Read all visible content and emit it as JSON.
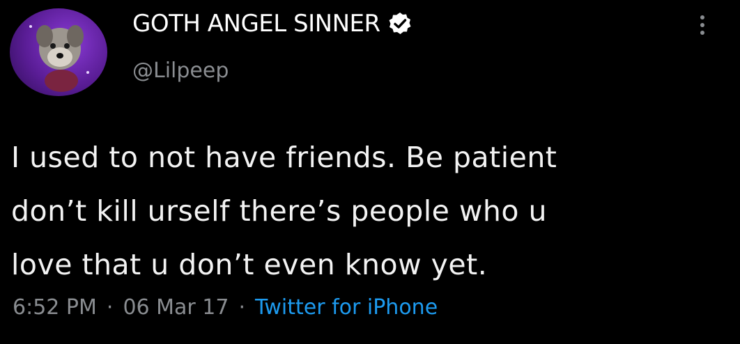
{
  "tweet": {
    "display_name": "GOTH ANGEL SINNER",
    "handle": "@Lilpeep",
    "verified": true,
    "text_lines": [
      "I used to not have friends. Be patient",
      "don’t kill urself there’s people who u",
      "love that u don’t even know yet."
    ],
    "time": "6:52 PM",
    "date": "06 Mar 17",
    "separator": "·",
    "source": "Twitter for iPhone"
  },
  "icons": {
    "avatar": "dog-avatar-icon",
    "verified": "verified-badge-icon",
    "more": "more-vertical-icon"
  },
  "colors": {
    "background": "#000000",
    "text": "#f3f3f3",
    "muted": "#8a8d91",
    "link": "#1d9bf0",
    "avatar_bg": "#5a1d96"
  }
}
